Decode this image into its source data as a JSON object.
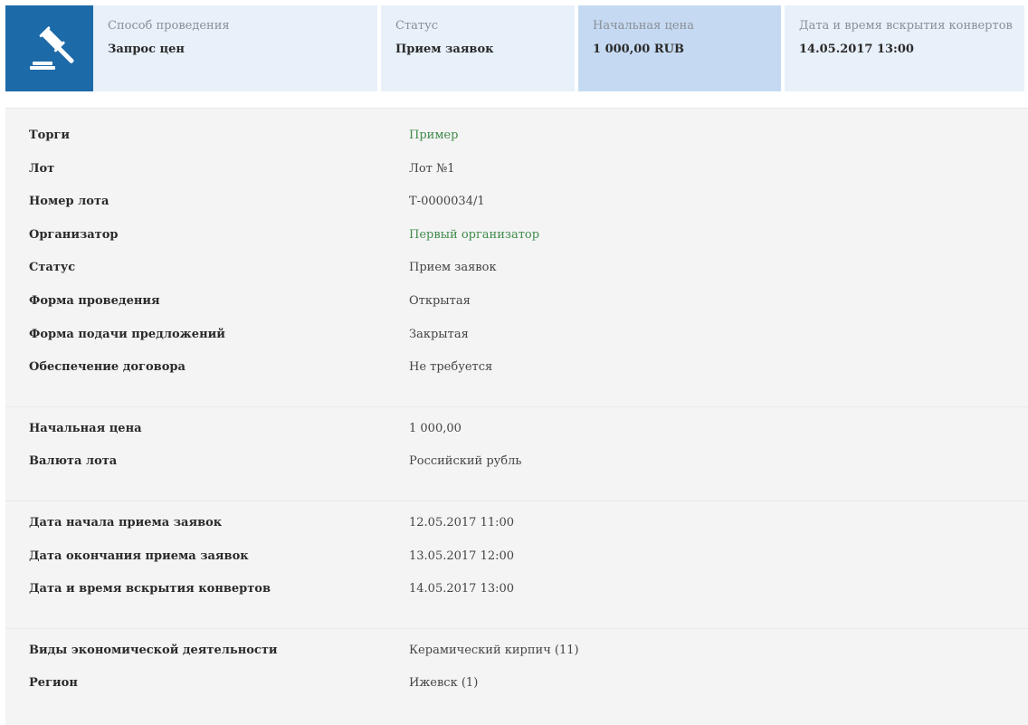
{
  "header": {
    "cells": [
      {
        "label": "Способ проведения",
        "value": "Запрос цен"
      },
      {
        "label": "Статус",
        "value": "Прием заявок"
      },
      {
        "label": "Начальная цена",
        "value": "1 000,00 RUB"
      },
      {
        "label": "Дата и время вскрытия конвертов",
        "value": "14.05.2017 13:00"
      }
    ]
  },
  "details": {
    "general": [
      {
        "label": "Торги",
        "value": "Пример"
      },
      {
        "label": "Лот",
        "value": "Лот №1"
      },
      {
        "label": "Номер лота",
        "value": "Т-0000034/1"
      },
      {
        "label": "Организатор",
        "value": "Первый организатор"
      },
      {
        "label": "Статус",
        "value": "Прием заявок"
      },
      {
        "label": "Форма проведения",
        "value": "Открытая"
      },
      {
        "label": "Форма подачи предложений",
        "value": "Закрытая"
      },
      {
        "label": "Обеспечение договора",
        "value": "Не требуется"
      }
    ],
    "price": [
      {
        "label": "Начальная цена",
        "value": "1 000,00"
      },
      {
        "label": "Валюта лота",
        "value": "Российский рубль"
      }
    ],
    "dates": [
      {
        "label": "Дата начала приема заявок",
        "value": "12.05.2017 11:00"
      },
      {
        "label": "Дата окончания приема заявок",
        "value": "13.05.2017 12:00"
      },
      {
        "label": "Дата и время вскрытия конвертов",
        "value": "14.05.2017 13:00"
      }
    ],
    "classification": [
      {
        "label": "Виды экономической деятельности",
        "value": "Керамический кирпич (11)"
      },
      {
        "label": "Регион",
        "value": "Ижевск (1)"
      }
    ]
  },
  "colors": {
    "brand": "#1d6aa8",
    "link": "#3f8a4a",
    "header_bg": "#e8f0fa",
    "header_accent_bg": "#c5daf2",
    "panel_bg": "#f4f4f4"
  },
  "icons": {
    "logo": "gavel-icon"
  }
}
